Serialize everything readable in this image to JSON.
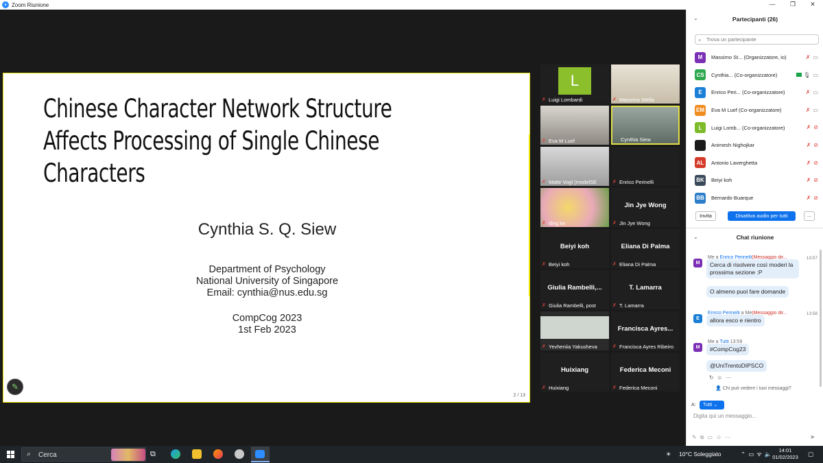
{
  "window": {
    "title": "Zoom Riunione"
  },
  "slide": {
    "title": "Chinese Character Network Structure Affects Processing of Single Chinese Characters",
    "title_lines": [
      "Chinese Character Network Structure",
      "Affects Processing of Single Chinese",
      "Characters"
    ],
    "author": "Cynthia S. Q. Siew",
    "dept_lines": [
      "Department of Psychology",
      "National University of Singapore",
      "Email: cynthia@nus.edu.sg"
    ],
    "conf_lines": [
      "CompCog 2023",
      "1st Feb 2023"
    ],
    "page": "2 / 13"
  },
  "tiles": [
    {
      "name": "Luigi Lombardi",
      "type": "avatar",
      "initial": "L",
      "muted": true
    },
    {
      "name": "Massimo Stella",
      "type": "camera",
      "muted": true
    },
    {
      "name": "Eva M Luef",
      "type": "camera",
      "muted": true
    },
    {
      "name": "Cynthia Siew",
      "type": "camera",
      "active": true,
      "muted": false
    },
    {
      "name": "Malte Vogl (modelSE",
      "type": "camera",
      "muted": true
    },
    {
      "name": "Enrico Perinelli",
      "type": "blank",
      "muted": true
    },
    {
      "name": "ding ke",
      "type": "camera",
      "muted": true
    },
    {
      "name": "Jin Jye Wong",
      "big": "Jin Jye Wong",
      "type": "name",
      "muted": true
    },
    {
      "name": "Beiyi koh",
      "big": "Beiyi koh",
      "type": "name",
      "muted": true
    },
    {
      "name": "Eliana Di Palma",
      "big": "Eliana Di Palma",
      "type": "name",
      "muted": true
    },
    {
      "name": "Giulia Rambelli, post",
      "big": "Giulia  Rambelli,...",
      "type": "name",
      "muted": true
    },
    {
      "name": "T. Lamarra",
      "big": "T. Lamarra",
      "type": "name",
      "muted": true
    },
    {
      "name": "Yevheniia Yakusheva",
      "type": "camera",
      "muted": true
    },
    {
      "name": "Francisca Ayres Ribeiro",
      "big": "Francisca  Ayres...",
      "type": "name",
      "muted": true
    },
    {
      "name": "Huixiang",
      "big": "Huixiang",
      "type": "name",
      "muted": true
    },
    {
      "name": "Federica Meconi",
      "big": "Federica Meconi",
      "type": "name",
      "muted": true
    }
  ],
  "participants": {
    "title": "Partecipanti (26)",
    "search_placeholder": "Trova un partecipante",
    "list": [
      {
        "initials": "M",
        "color": "#7b2fb5",
        "name": "Massimo St...",
        "role": "(Organizzatore, io)",
        "mic": "muted",
        "video": true
      },
      {
        "initials": "CS",
        "color": "#2fa84f",
        "name": "Cynthia...",
        "role": "(Co-organizzatore)",
        "mic": "on",
        "video": true,
        "sharing": true
      },
      {
        "initials": "E",
        "color": "#1a7fd6",
        "name": "Enrico Peri...",
        "role": "(Co-organizzatore)",
        "mic": "muted",
        "video": true
      },
      {
        "initials": "EM",
        "color": "#f08c1e",
        "name": "Eva M Luef",
        "role": "(Co-organizzatore)",
        "mic": "muted",
        "video": true
      },
      {
        "initials": "L",
        "color": "#7dbb2a",
        "name": "Luigi Lomb...",
        "role": "(Co-organizzatore)",
        "mic": "muted",
        "video": false
      },
      {
        "initials": "",
        "color": "#1b1b1b",
        "name": "Animesh Nighojkar",
        "role": "",
        "mic": "muted",
        "video": false
      },
      {
        "initials": "AL",
        "color": "#d53b2a",
        "name": "Antonio Laverghetta",
        "role": "",
        "mic": "muted",
        "video": false
      },
      {
        "initials": "BK",
        "color": "#3b4a5a",
        "name": "Beiyi koh",
        "role": "",
        "mic": "muted",
        "video": false
      },
      {
        "initials": "BB",
        "color": "#2d7fc9",
        "name": "Bernardo Buarque",
        "role": "",
        "mic": "muted",
        "video": false
      }
    ],
    "invite_label": "Invita",
    "mute_all_label": "Disattiva audio per tutti",
    "more_label": "..."
  },
  "chat": {
    "title": "Chat riunione",
    "messages": [
      {
        "from": "Me",
        "to_word": "a",
        "to": "Enrico Perinelli",
        "tag": "(Messaggio dir...",
        "time": "13:57",
        "bubbles": [
          "Cerca di risolvere così moderi la prossima sezione :P",
          "O almeno puoi fare domande"
        ]
      },
      {
        "from": "Enrico Perinelli",
        "to_word": "a",
        "to": "Me",
        "tag": "(Messaggio dir...",
        "time": "13:58",
        "bubbles": [
          "allora esco e rientro"
        ]
      },
      {
        "from": "Me",
        "to_word": "a",
        "to": "Tutti",
        "tag": "",
        "time": "13:59",
        "bubbles": [
          "#CompCog23",
          "@UniTrentoDIPSCO"
        ]
      }
    ],
    "who_can_see": "Chi può vedere i tuoi messaggi?",
    "to_label": "A:",
    "to_value": "Tutti",
    "input_placeholder": "Digita qui un messaggio..."
  },
  "taskbar": {
    "search_label": "Cerca",
    "weather": "10°C  Soleggiato",
    "time": "14:01",
    "date": "01/02/2023"
  },
  "colors": {
    "zoom_blue": "#0e72ed",
    "muted_red": "#e0433a",
    "active_border": "#e3e14a"
  }
}
